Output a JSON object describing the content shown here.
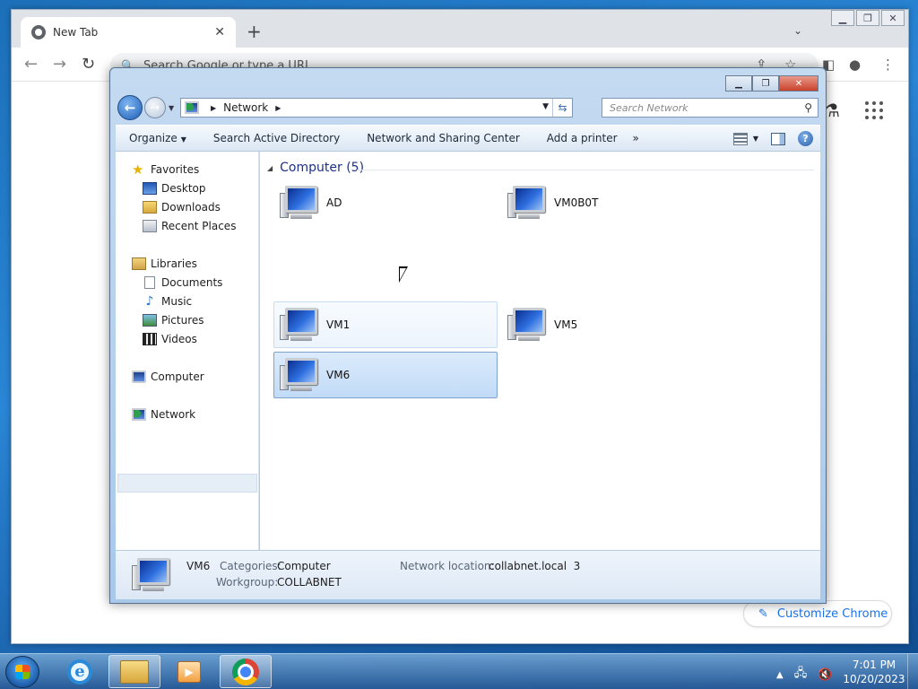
{
  "chrome": {
    "tab_title": "New Tab",
    "new_tab": "+",
    "omnibox_placeholder": "Search Google or type a URL",
    "customize_label": "Customize Chrome"
  },
  "explorer": {
    "address": {
      "crumb": "Network"
    },
    "search_placeholder": "Search Network",
    "commands": {
      "organize": "Organize",
      "search_ad": "Search Active Directory",
      "network_center": "Network and Sharing Center",
      "add_printer": "Add a printer",
      "more": "»"
    },
    "nav": {
      "favorites": "Favorites",
      "desktop": "Desktop",
      "downloads": "Downloads",
      "recent": "Recent Places",
      "libraries": "Libraries",
      "documents": "Documents",
      "music": "Music",
      "pictures": "Pictures",
      "videos": "Videos",
      "computer": "Computer",
      "network": "Network"
    },
    "group_title": "Computer (5)",
    "items": [
      "AD",
      "VM0B0T",
      "VM1",
      "VM5",
      "VM6"
    ],
    "details": {
      "name": "VM6",
      "categories_label": "Categories:",
      "categories_value": "Computer",
      "workgroup_label": "Workgroup:",
      "workgroup_value": "COLLABNET",
      "location_label": "Network location:",
      "location_value": "collabnet.local  3"
    }
  },
  "taskbar": {
    "time": "7:01 PM",
    "date": "10/20/2023"
  },
  "colors": {
    "desktop_blue": "#2a86d6",
    "selection_blue": "#c1dbf7",
    "chrome_accent": "#1a73e8"
  }
}
